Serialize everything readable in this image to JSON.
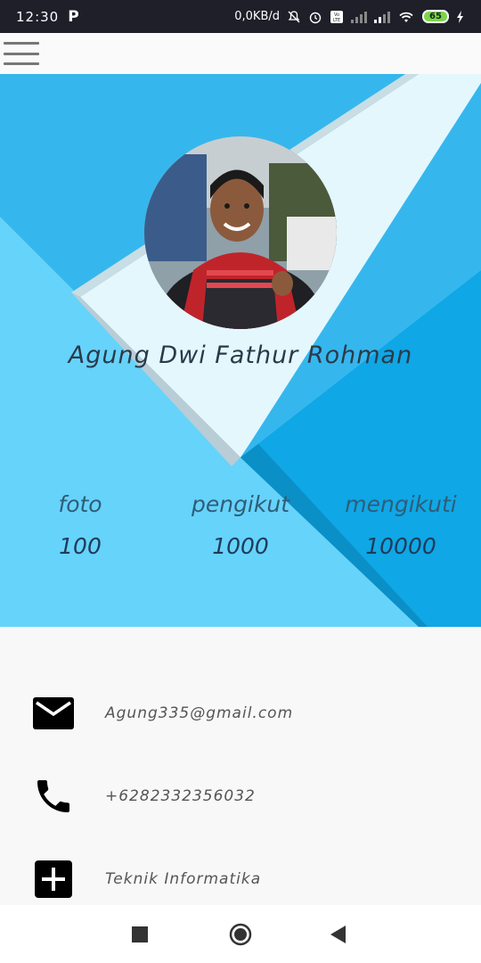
{
  "status_bar": {
    "time": "12:30",
    "app_badge": "P",
    "network_speed": "0,0KB/d",
    "volte": "Vo LTE",
    "battery_level": "65"
  },
  "profile": {
    "name": "Agung Dwi Fathur Rohman"
  },
  "stats": [
    {
      "label": "foto",
      "value": "100"
    },
    {
      "label": "pengikut",
      "value": "1000"
    },
    {
      "label": "mengikuti",
      "value": "10000"
    }
  ],
  "contacts": {
    "email": "Agung335@gmail.com",
    "phone": "+6282332356032",
    "major": "Teknik Informatika"
  },
  "colors": {
    "header_light": "#66d3fb",
    "header_mid": "#35b7ee",
    "header_dark": "#0fa7e6",
    "text_dark": "#2b3a4a"
  },
  "icons": {
    "menu": "hamburger-icon",
    "email": "mail-icon",
    "phone": "phone-icon",
    "add": "add-box-icon",
    "nav_recent": "square-icon",
    "nav_home": "circle-icon",
    "nav_back": "triangle-back-icon"
  }
}
